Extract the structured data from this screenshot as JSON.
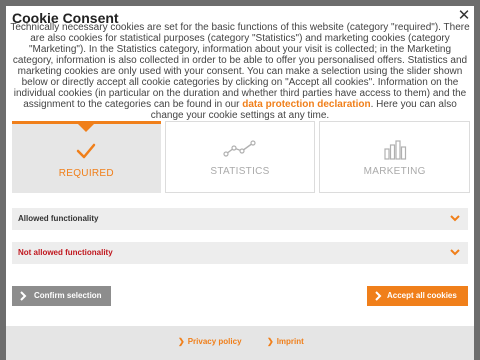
{
  "modal": {
    "title": "Cookie Consent",
    "close_label": "✕",
    "intro_before_link": "Technically necessary cookies are set for the basic functions of this website (category \"required\"). There are also cookies for statistical purposes (category \"Statistics\") and marketing cookies (category \"Marketing\"). In the Statistics category, information about your visit is collected; in the Marketing category, information is also collected in order to be able to offer you personalised offers. Statistics and marketing cookies are only used with your consent. You can make a selection using the slider shown below or directly accept all cookie categories by clicking on \"Accept all cookies\". Information on the individual cookies (in particular on the duration and whether third parties have access to them) and the assignment to the categories can be found in our ",
    "intro_link": "data protection declaration",
    "intro_after_link": ". Here you can also change your cookie settings at any time."
  },
  "categories": [
    {
      "label": "REQUIRED",
      "icon": "checkmark-icon",
      "selected": true
    },
    {
      "label": "STATISTICS",
      "icon": "line-chart-icon",
      "selected": false
    },
    {
      "label": "MARKETING",
      "icon": "bar-chart-icon",
      "selected": false
    }
  ],
  "functionality": {
    "allowed_label": "Allowed functionality",
    "not_allowed_label": "Not allowed functionality"
  },
  "buttons": {
    "confirm_label": "Confirm selection",
    "accept_label": "Accept all cookies"
  },
  "footer": {
    "privacy_label": "Privacy policy",
    "imprint_label": "Imprint"
  },
  "colors": {
    "accent": "#f07f1a",
    "danger": "#c0171e",
    "muted_button": "#8d8d8d"
  }
}
